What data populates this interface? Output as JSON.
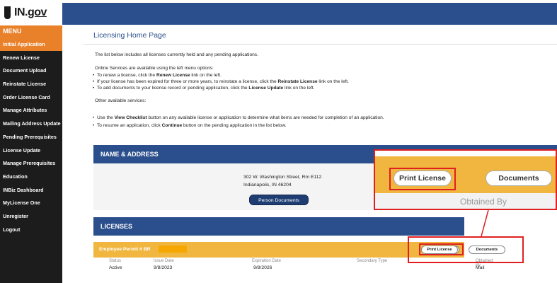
{
  "header": {
    "logo_prefix": "IN.",
    "logo_suffix": "gov"
  },
  "sidebar": {
    "menu_label": "MENU",
    "items": [
      {
        "label": "Initial Application",
        "active": true
      },
      {
        "label": "Renew License"
      },
      {
        "label": "Document Upload"
      },
      {
        "label": "Reinstate License"
      },
      {
        "label": "Order License Card"
      },
      {
        "label": "Manage Attributes"
      },
      {
        "label": "Mailing Address Update"
      },
      {
        "label": "Pending Prerequisites"
      },
      {
        "label": "License Update"
      },
      {
        "label": "Manage Prerequisites"
      },
      {
        "label": "Education"
      },
      {
        "label": "INBiz Dashboard"
      },
      {
        "label": "MyLicense One"
      },
      {
        "label": "Unregister"
      },
      {
        "label": "Logout"
      }
    ]
  },
  "main": {
    "title": "Licensing Home Page",
    "intro": "The list below includes all licenses currently held and any pending applications.",
    "online_services": "Online Services are available using the left menu options:",
    "bullets1": [
      {
        "pre": "To renew a license, click the ",
        "bold": "Renew License",
        "post": " link on the left."
      },
      {
        "pre": "If your license has been expired for three or more years, to reinstate a license, click the ",
        "bold": "Reinstate License",
        "post": " link on the left."
      },
      {
        "pre": "To add documents to your license record or pending application, click the ",
        "bold": "License Update",
        "post": " link on the left."
      }
    ],
    "other_services": "Other available services:",
    "bullets2": [
      {
        "pre": "Use the ",
        "bold": "View Checklist",
        "post": " button on any available license or application to determine what items are needed for completion of an application."
      },
      {
        "pre": "To resume an application, click ",
        "bold": "Continue",
        "post": " button on the pending application in the list below."
      }
    ],
    "name_address_title": "NAME & ADDRESS",
    "address_line1": "302 W. Washington Street, Rm E112",
    "address_line2": "Indianapolis, IN 46204",
    "person_documents_btn": "Person Documents",
    "licenses_title": "LICENSES",
    "license": {
      "title": "Employee Permit   # BR",
      "print_btn": "Print License",
      "documents_btn": "Documents",
      "columns": [
        "Status",
        "Issue Date",
        "Expiration Date",
        "Secondary Type",
        "Obtained By"
      ],
      "values": [
        "Active",
        "9/8/2023",
        "9/8/2026",
        "",
        "Mail"
      ]
    }
  },
  "zoom_callout": {
    "print_btn": "Print License",
    "documents_btn": "Documents",
    "obtained_by": "Obtained By"
  },
  "colors": {
    "header_blue": "#2b4f8c",
    "accent_orange": "#e8812a",
    "license_gold": "#f1b640",
    "callout_red": "#e02020"
  }
}
